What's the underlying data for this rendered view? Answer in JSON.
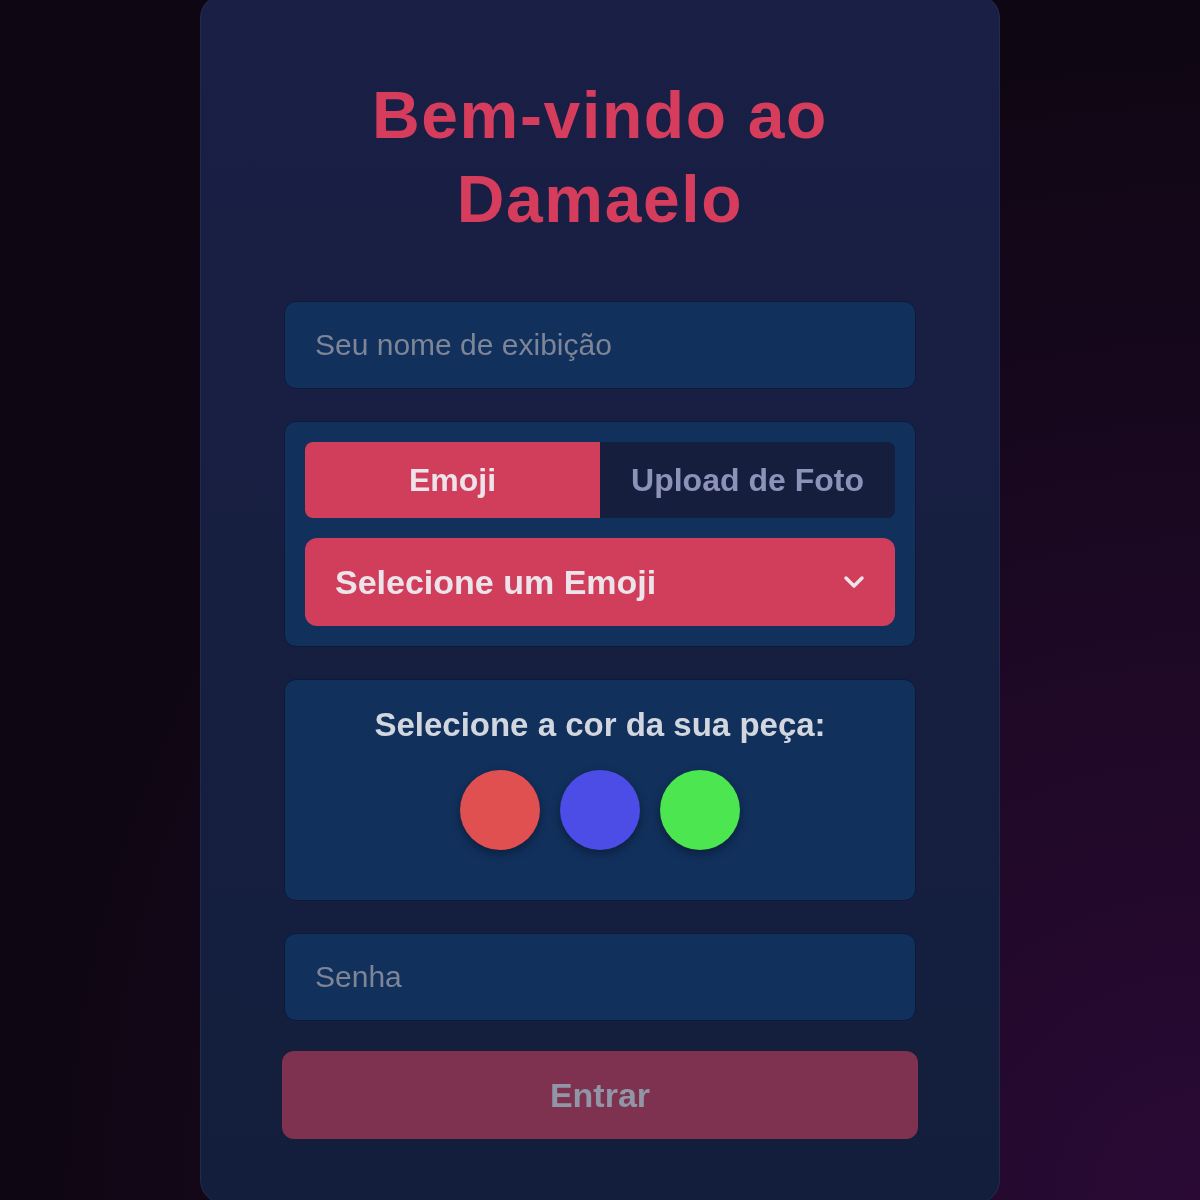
{
  "title": "Bem-vindo ao Damaelo",
  "name_field": {
    "placeholder": "Seu nome de exibição"
  },
  "avatar_tabs": [
    {
      "label": "Emoji",
      "selected": true
    },
    {
      "label": "Upload de Foto",
      "selected": false
    }
  ],
  "emoji_select": {
    "value": "Selecione um Emoji"
  },
  "color_picker": {
    "label": "Selecione a cor da sua peça:",
    "swatches": [
      {
        "color": "#e05050",
        "selected": false
      },
      {
        "color": "#4c4ce6",
        "selected": false
      },
      {
        "color": "#4ce650",
        "selected": false
      }
    ]
  },
  "password_field": {
    "placeholder": "Senha"
  },
  "submit_button": {
    "label": "Entrar",
    "disabled": true
  }
}
